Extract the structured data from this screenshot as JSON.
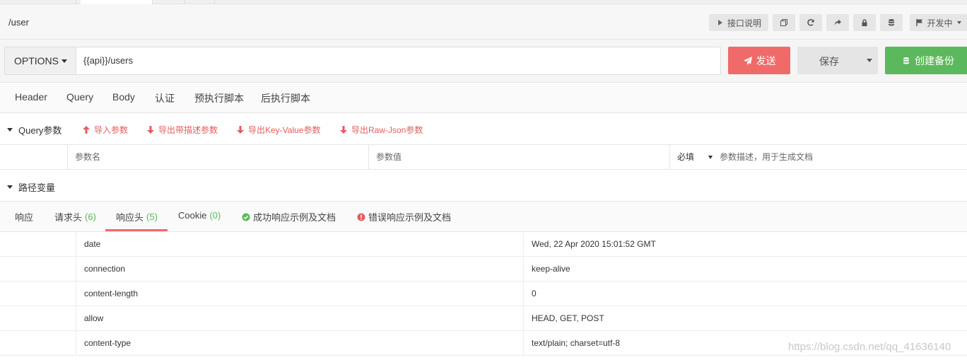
{
  "topbar": {
    "path": "/user",
    "doc_label": "接口说明",
    "status_label": "开发中"
  },
  "request": {
    "method": "OPTIONS",
    "url": "{{api}}/users",
    "send_label": "发送",
    "save_label": "保存",
    "backup_label": "创建备份"
  },
  "subtabs": [
    "Header",
    "Query",
    "Body",
    "认证",
    "预执行脚本",
    "后执行脚本"
  ],
  "query": {
    "title": "Query参数",
    "import": "导入参数",
    "export_desc": "导出带描述参数",
    "export_kv": "导出Key-Value参数",
    "export_raw": "导出Raw-Json参数",
    "col_name": "参数名",
    "col_value": "参数值",
    "required": "必填",
    "desc_placeholder": "参数描述，用于生成文档"
  },
  "path_vars": {
    "title": "路径变量"
  },
  "response_tabs": {
    "response": "响应",
    "req_headers": "请求头",
    "req_headers_count": "(6)",
    "resp_headers": "响应头",
    "resp_headers_count": "(5)",
    "cookie": "Cookie",
    "cookie_count": "(0)",
    "success_doc": "成功响应示例及文档",
    "error_doc": "错误响应示例及文档"
  },
  "headers": [
    {
      "name": "date",
      "value": "Wed, 22 Apr 2020 15:01:52 GMT"
    },
    {
      "name": "connection",
      "value": "keep-alive"
    },
    {
      "name": "content-length",
      "value": "0"
    },
    {
      "name": "allow",
      "value": "HEAD, GET, POST"
    },
    {
      "name": "content-type",
      "value": "text/plain; charset=utf-8"
    }
  ],
  "watermark": "https://blog.csdn.net/qq_41636140",
  "colors": {
    "send": "#f16a6a",
    "backup": "#5cb85c",
    "link": "#e65c5c",
    "count": "#5cb85c"
  }
}
